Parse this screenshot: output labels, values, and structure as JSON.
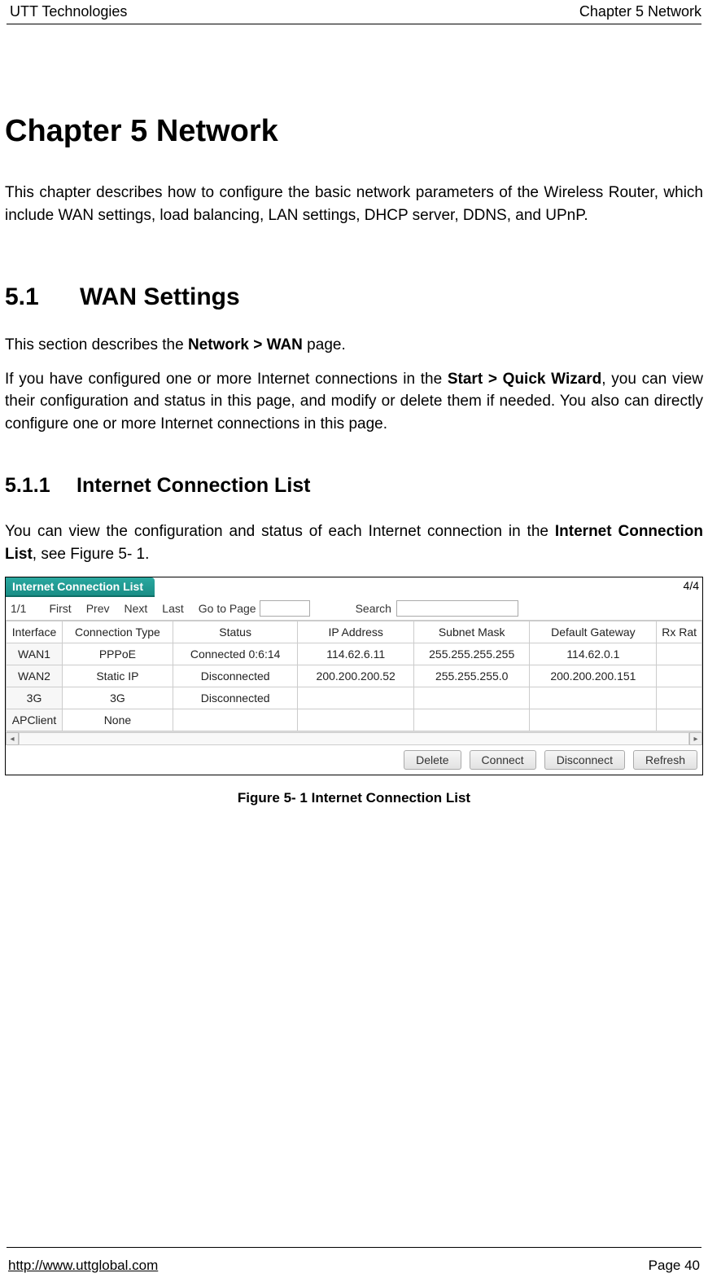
{
  "header": {
    "left": "UTT Technologies",
    "right": "Chapter 5 Network"
  },
  "chapter_title": "Chapter 5  Network",
  "intro_before": "This chapter describes how to configure the basic network parameters of the Wireless Router, which include WAN settings, load balancing, LAN settings, DHCP server, DDNS, and UPnP.",
  "section": {
    "num": "5.1",
    "title": "WAN Settings"
  },
  "section_p1_a": "This section describes the ",
  "section_p1_bold": "Network > WAN",
  "section_p1_b": " page.",
  "section_p2_a": "If you have configured one or more Internet connections in the ",
  "section_p2_bold": "Start > Quick Wizard",
  "section_p2_b": ", you can view their configuration and status in this page, and modify or delete them if needed. You also can directly configure one or more Internet connections in this page.",
  "subsection": {
    "num": "5.1.1",
    "title": "Internet Connection List"
  },
  "sub_p_a": "You can view the configuration and status of each Internet connection in the ",
  "sub_p_bold": "Internet Connection List",
  "sub_p_b": ", see Figure 5- 1.",
  "panel": {
    "title": "Internet Connection List",
    "count": "4/4",
    "pager": {
      "pos": "1/1",
      "first": "First",
      "prev": "Prev",
      "next": "Next",
      "last": "Last",
      "goto": "Go to",
      "page": "Page",
      "search": "Search"
    },
    "cols": {
      "interface": "Interface",
      "ctype": "Connection Type",
      "status": "Status",
      "ip": "IP Address",
      "mask": "Subnet Mask",
      "gw": "Default Gateway",
      "rx": "Rx Rat"
    },
    "rows": [
      {
        "if": "WAN1",
        "ct": "PPPoE",
        "st": "Connected 0:6:14",
        "ip": "114.62.6.11",
        "sm": "255.255.255.255",
        "gw": "114.62.0.1",
        "rx": ""
      },
      {
        "if": "WAN2",
        "ct": "Static IP",
        "st": "Disconnected",
        "ip": "200.200.200.52",
        "sm": "255.255.255.0",
        "gw": "200.200.200.151",
        "rx": ""
      },
      {
        "if": "3G",
        "ct": "3G",
        "st": "Disconnected",
        "ip": "",
        "sm": "",
        "gw": "",
        "rx": ""
      },
      {
        "if": "APClient",
        "ct": "None",
        "st": "",
        "ip": "",
        "sm": "",
        "gw": "",
        "rx": ""
      }
    ],
    "buttons": {
      "delete": "Delete",
      "connect": "Connect",
      "disconnect": "Disconnect",
      "refresh": "Refresh"
    }
  },
  "figure_caption": "Figure 5- 1 Internet Connection List",
  "footer": {
    "link": "http://www.uttglobal.com",
    "page": "Page 40"
  }
}
